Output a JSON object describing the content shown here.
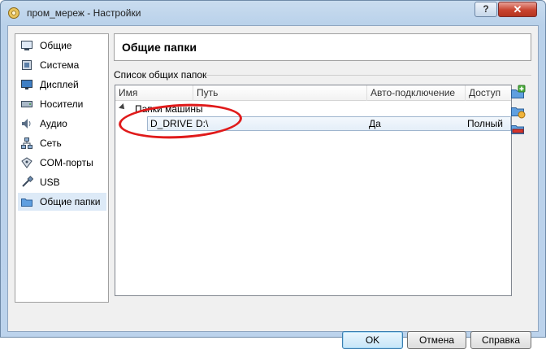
{
  "window": {
    "title": "пром_мереж - Настройки",
    "help_label": "?",
    "close_label": "✕"
  },
  "sidebar": {
    "items": [
      {
        "label": "Общие",
        "icon": "general-icon"
      },
      {
        "label": "Система",
        "icon": "system-icon"
      },
      {
        "label": "Дисплей",
        "icon": "display-icon"
      },
      {
        "label": "Носители",
        "icon": "storage-icon"
      },
      {
        "label": "Аудио",
        "icon": "audio-icon"
      },
      {
        "label": "Сеть",
        "icon": "network-icon"
      },
      {
        "label": "COM-порты",
        "icon": "com-ports-icon"
      },
      {
        "label": "USB",
        "icon": "usb-icon"
      },
      {
        "label": "Общие папки",
        "icon": "shared-folders-icon",
        "selected": true
      }
    ]
  },
  "panel": {
    "title": "Общие папки"
  },
  "shared_folders": {
    "group_label": "Список общих папок",
    "columns": [
      "Имя",
      "Путь",
      "Авто-подключение",
      "Доступ"
    ],
    "groups": [
      {
        "label": "Папки машины",
        "rows": [
          {
            "name": "D_DRIVE",
            "path": "D:\\",
            "auto_mount": "Да",
            "access": "Полный"
          }
        ]
      }
    ]
  },
  "toolbar": {
    "add_icon": "add-folder-icon",
    "edit_icon": "edit-folder-icon",
    "remove_icon": "remove-folder-icon"
  },
  "buttons": {
    "ok": "OK",
    "cancel": "Отмена",
    "help": "Справка"
  },
  "colors": {
    "annotation": "#e01a1a",
    "selection": "#ddeaf7"
  }
}
